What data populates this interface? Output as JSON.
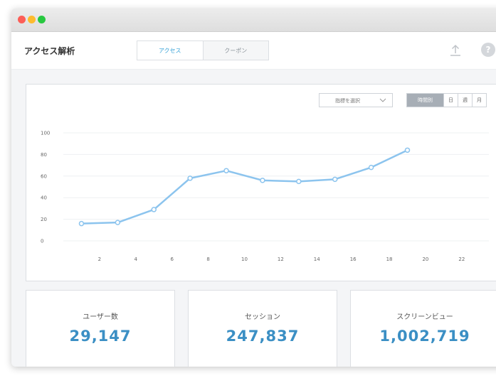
{
  "app": {
    "title": "アクセス解析",
    "tabs": [
      {
        "label": "アクセス",
        "active": true
      },
      {
        "label": "クーポン",
        "active": false
      }
    ],
    "upload_icon": "upload-icon",
    "help_label": "?"
  },
  "controls": {
    "metric_select_label": "指標を選択",
    "periods": [
      {
        "label": "時間別",
        "active": true
      },
      {
        "label": "日",
        "active": false
      },
      {
        "label": "週",
        "active": false
      },
      {
        "label": "月",
        "active": false
      }
    ]
  },
  "colors": {
    "accent": "#3ba4d8",
    "line": "#8cc4ee",
    "stat_value": "#3b8fc4"
  },
  "chart_data": {
    "type": "line",
    "x": [
      1,
      3,
      5,
      7,
      9,
      11,
      13,
      15,
      17,
      19
    ],
    "values": [
      16,
      17,
      29,
      58,
      65,
      56,
      55,
      57,
      68,
      84
    ],
    "xticks": [
      2,
      4,
      6,
      8,
      10,
      12,
      14,
      16,
      18,
      20,
      22
    ],
    "xlim": [
      0,
      23.5
    ],
    "yticks": [
      0,
      20,
      40,
      60,
      80,
      100
    ],
    "ylim": [
      0,
      100
    ],
    "grid": "horizontal"
  },
  "stats": [
    {
      "label": "ユーザー数",
      "value": "29,147"
    },
    {
      "label": "セッション",
      "value": "247,837"
    },
    {
      "label": "スクリーンビュー",
      "value": "1,002,719"
    }
  ]
}
